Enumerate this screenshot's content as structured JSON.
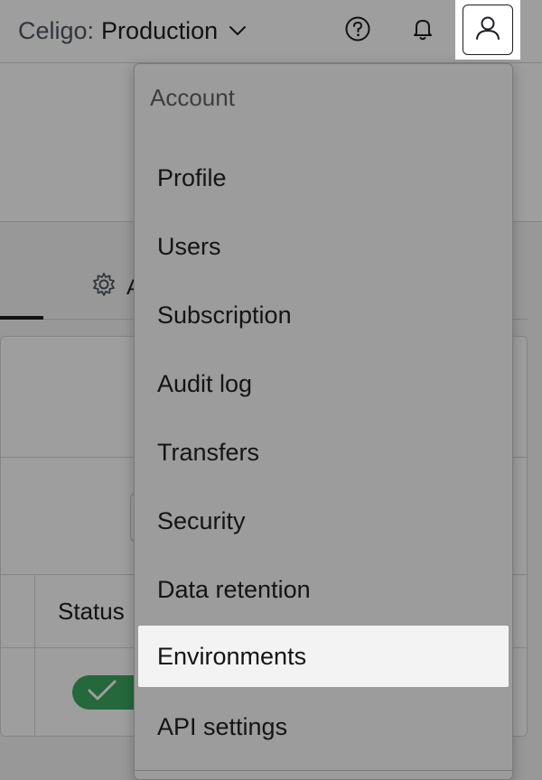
{
  "topbar": {
    "env_prefix": "Celigo:",
    "env_name": "Production",
    "icons": {
      "env_chevron": "chevron-down-icon",
      "help": "help-circle-icon",
      "notifications": "bell-icon",
      "profile": "user-icon"
    }
  },
  "background": {
    "tab_icon": "gear-icon",
    "tab_partial_label": "A",
    "status_header": "Status"
  },
  "menu": {
    "heading": "Account",
    "items": [
      {
        "label": "Profile"
      },
      {
        "label": "Users"
      },
      {
        "label": "Subscription"
      },
      {
        "label": "Audit log"
      },
      {
        "label": "Transfers"
      },
      {
        "label": "Security"
      },
      {
        "label": "Data retention"
      },
      {
        "label": "Environments"
      },
      {
        "label": "API settings"
      }
    ],
    "active_item": "Environments"
  },
  "colors": {
    "scrim": "#00000061",
    "menu_background": "#9c9c9c",
    "active_item_background": "#f3f3f3",
    "toggle_on": "#3ca860"
  }
}
